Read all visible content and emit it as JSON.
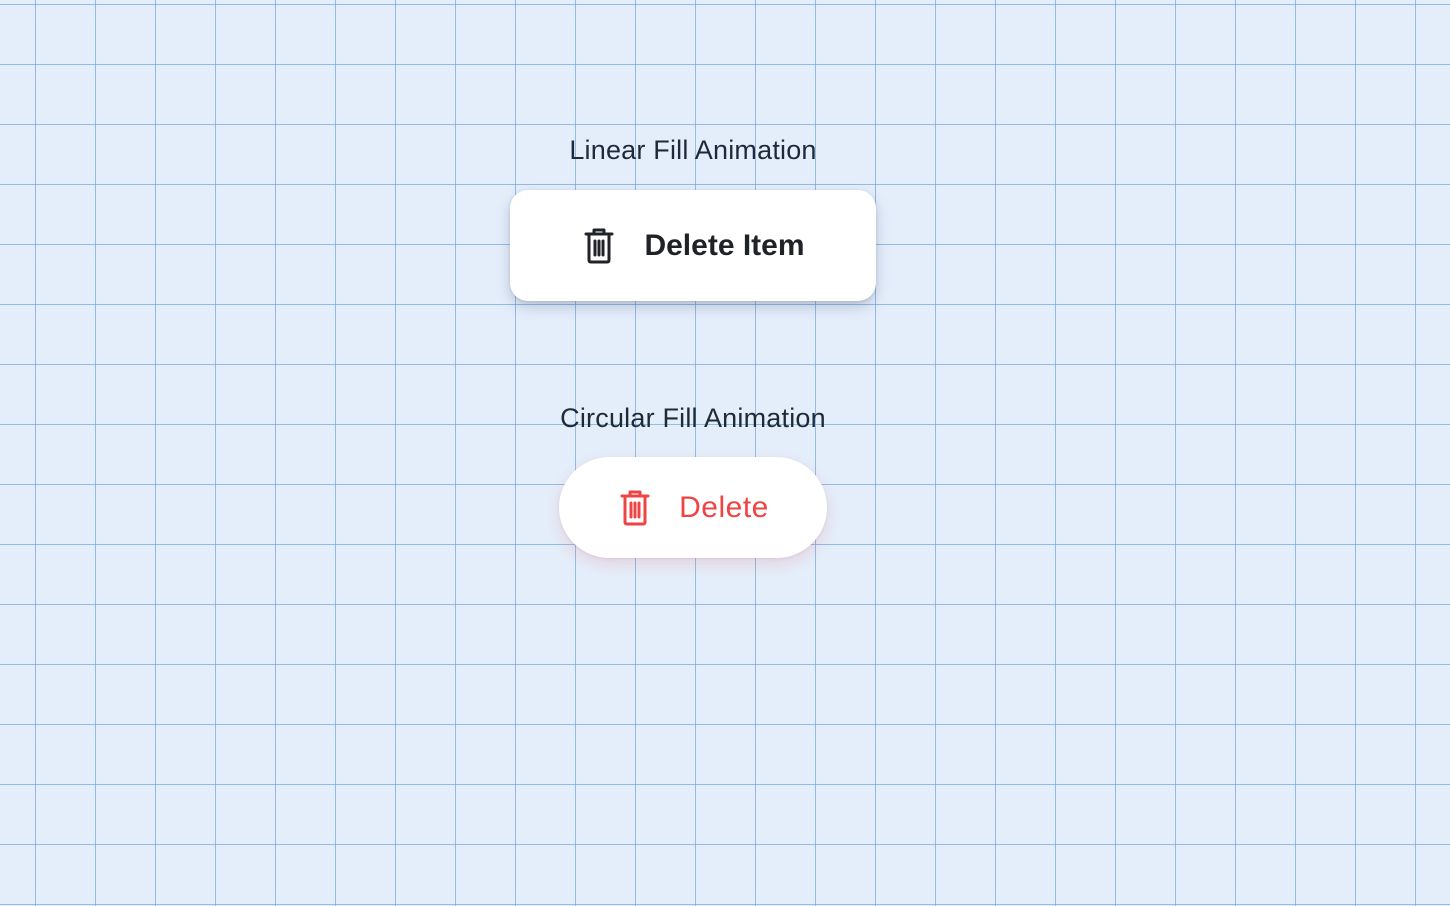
{
  "linear": {
    "heading": "Linear Fill Animation",
    "button_label": "Delete Item",
    "icon": "trash-icon",
    "text_color": "#1f2328"
  },
  "circular": {
    "heading": "Circular Fill Animation",
    "button_label": "Delete",
    "icon": "trash-icon",
    "text_color": "#ef4444"
  },
  "colors": {
    "background": "#e4eefb",
    "grid_line": "#78aadc",
    "button_bg": "#ffffff"
  }
}
